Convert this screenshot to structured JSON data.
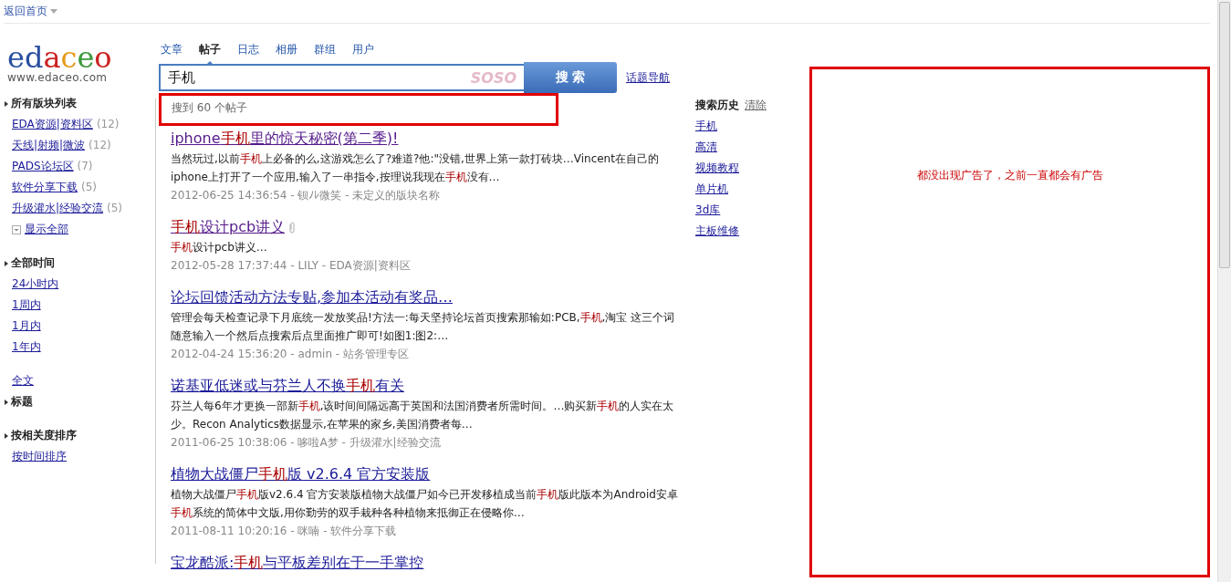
{
  "topbar": {
    "home_link": "返回首页"
  },
  "logo": {
    "text": "edaceo",
    "tagline": "www.edaceo.com"
  },
  "tabs": [
    {
      "label": "文章",
      "selected": false
    },
    {
      "label": "帖子",
      "selected": true
    },
    {
      "label": "日志",
      "selected": false
    },
    {
      "label": "相册",
      "selected": false
    },
    {
      "label": "群组",
      "selected": false
    },
    {
      "label": "用户",
      "selected": false
    }
  ],
  "search": {
    "value": "手机",
    "brand": "SOSO",
    "button": "搜 索",
    "topic_link": "话题导航"
  },
  "sidebar": [
    {
      "heading": "所有版块列表",
      "items": [
        {
          "label": "EDA资源|资料区",
          "count": "(12)"
        },
        {
          "label": "天线|射频|微波",
          "count": "(12)"
        },
        {
          "label": "PADS论坛区",
          "count": "(7)"
        },
        {
          "label": "软件分享下载",
          "count": "(5)"
        },
        {
          "label": "升级灌水|经验交流",
          "count": "(5)"
        }
      ],
      "show_all": "显示全部"
    },
    {
      "heading": "全部时间",
      "items": [
        {
          "label": "24小时内"
        },
        {
          "label": "1周内"
        },
        {
          "label": "1月内"
        },
        {
          "label": "1年内"
        }
      ]
    },
    {
      "pre_link": "全文",
      "heading": "标题"
    },
    {
      "heading": "按相关度排序",
      "items": [
        {
          "label": "按时间排序"
        }
      ]
    }
  ],
  "result_count": "搜到 60 个帖子",
  "results": [
    {
      "title": [
        {
          "t": "iphone"
        },
        {
          "t": "手机",
          "hl": true
        },
        {
          "t": "里的惊天秘密(第二季)!"
        }
      ],
      "visited": true,
      "attachment": false,
      "snippet": [
        {
          "t": "当然玩过,以前"
        },
        {
          "t": "手机",
          "hl": true
        },
        {
          "t": "上必备的么,这游戏怎么了?难道?他:\"没错,世界上第一款打砖块…Vincent在自己的iphone上打开了一个应用,输入了一串指令,按理说我现在"
        },
        {
          "t": "手机",
          "hl": true
        },
        {
          "t": "没有…"
        }
      ],
      "meta": "2012-06-25 14:36:54 - 钡ﾉﾚ微笑 - 未定义的版块名称"
    },
    {
      "title": [
        {
          "t": "手机",
          "hl": true
        },
        {
          "t": "设计pcb讲义"
        }
      ],
      "visited": true,
      "attachment": true,
      "snippet": [
        {
          "t": "手机",
          "hl": true
        },
        {
          "t": "设计pcb讲义…"
        }
      ],
      "meta": "2012-05-28 17:37:44 - LILY - EDA资源|资料区"
    },
    {
      "title": [
        {
          "t": "论坛回馈活动方法专贴,参加本活动有奖品…"
        }
      ],
      "visited": false,
      "attachment": false,
      "snippet": [
        {
          "t": "管理会每天检查记录下月底统一发放奖品!方法一:每天坚持论坛首页搜索那输如:PCB,"
        },
        {
          "t": "手机",
          "hl": true
        },
        {
          "t": ",淘宝 这三个词随意输入一个然后点搜索后点里面推广即可!如图1:图2:…"
        }
      ],
      "meta": "2012-04-24 15:36:20 - admin - 站务管理专区"
    },
    {
      "title": [
        {
          "t": "诺基亚低迷或与芬兰人不换"
        },
        {
          "t": "手机",
          "hl": true
        },
        {
          "t": "有关"
        }
      ],
      "visited": false,
      "attachment": false,
      "snippet": [
        {
          "t": "芬兰人每6年才更换一部新"
        },
        {
          "t": "手机",
          "hl": true
        },
        {
          "t": ",该时间间隔远高于英国和法国消费者所需时间。…购买新"
        },
        {
          "t": "手机",
          "hl": true
        },
        {
          "t": "的人实在太少。Recon Analytics数据显示,在苹果的家乡,美国消费者每…"
        }
      ],
      "meta": "2011-06-25 10:38:06 - 哆啦A梦 - 升级灌水|经验交流"
    },
    {
      "title": [
        {
          "t": "植物大战僵尸"
        },
        {
          "t": "手机",
          "hl": true
        },
        {
          "t": "版 v2.6.4 官方安装版"
        }
      ],
      "visited": false,
      "attachment": false,
      "snippet": [
        {
          "t": "植物大战僵尸"
        },
        {
          "t": "手机",
          "hl": true
        },
        {
          "t": "版v2.6.4 官方安装版植物大战僵尸如今已开发移植成当前"
        },
        {
          "t": "手机",
          "hl": true
        },
        {
          "t": "版此版本为Android安卓"
        },
        {
          "t": "手机",
          "hl": true
        },
        {
          "t": "系统的简体中文版,用你勤劳的双手栽种各种植物来抵御正在侵略你…"
        }
      ],
      "meta": "2011-08-11 10:20:16 - 咪喃 - 软件分享下载"
    },
    {
      "title": [
        {
          "t": "宝龙酷派:"
        },
        {
          "t": "手机",
          "hl": true
        },
        {
          "t": "与平板差别在于一手掌控"
        }
      ],
      "visited": false,
      "attachment": false
    }
  ],
  "history": {
    "title": "搜索历史",
    "clear": "清除",
    "items": [
      "手机",
      "高清",
      "视频教程",
      "单片机",
      "3d库",
      "主板维修"
    ]
  },
  "annotation": {
    "note": "都没出现广告了，之前一直都会有广告"
  }
}
